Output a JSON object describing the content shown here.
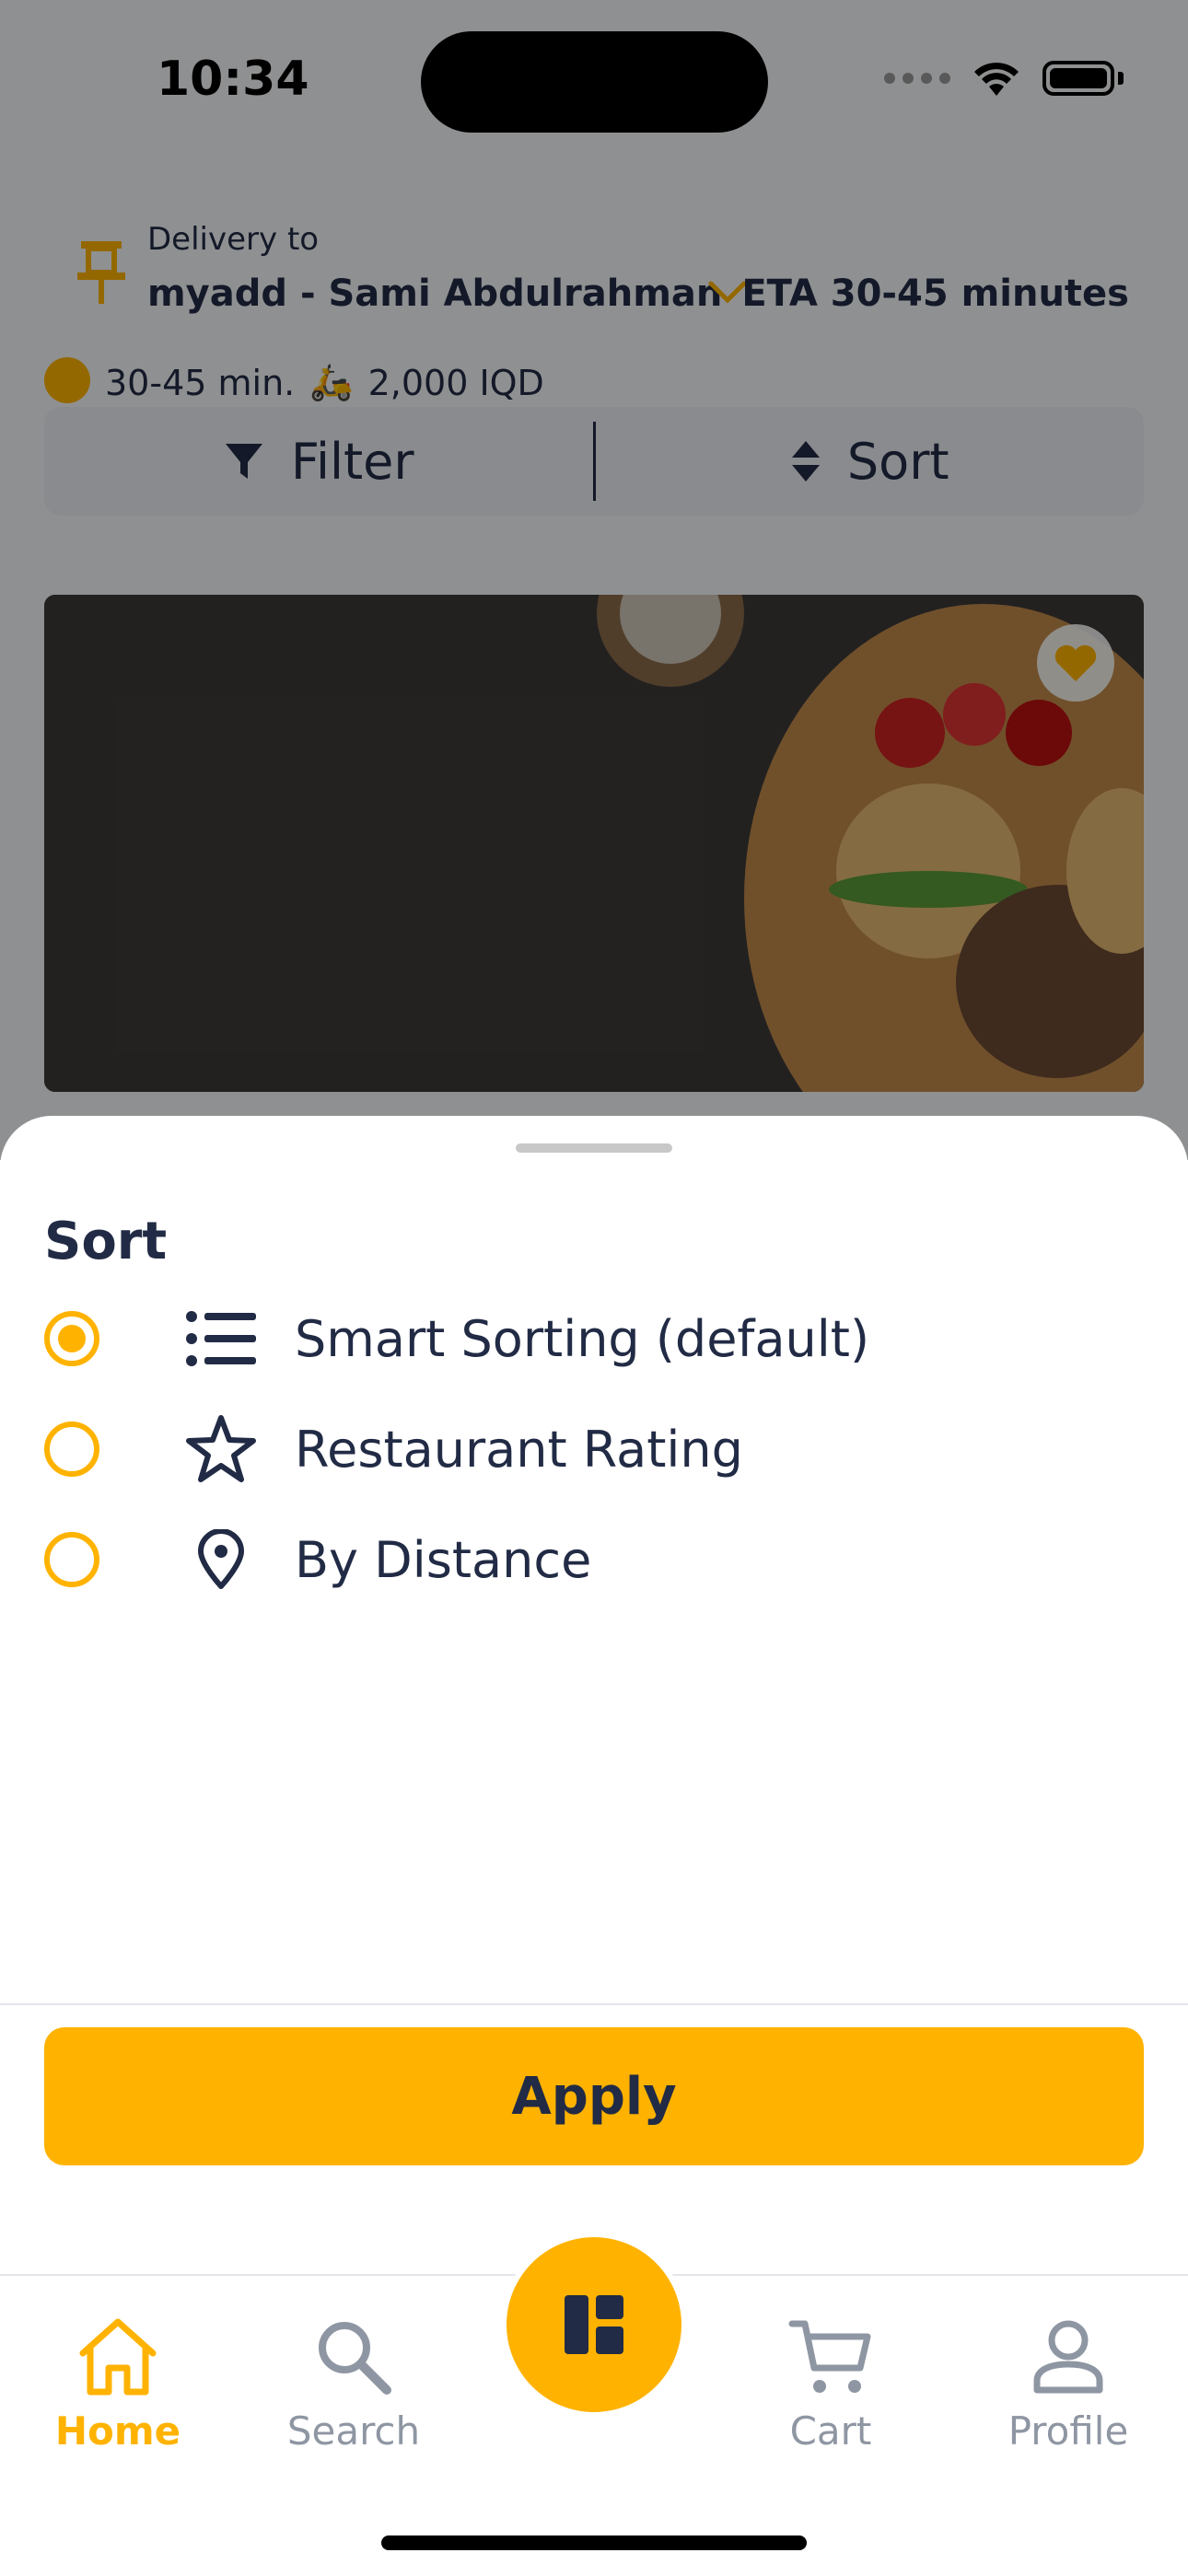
{
  "status_bar": {
    "time": "10:34"
  },
  "header": {
    "delivery_label": "Delivery to",
    "address": "myadd - Sami Abdulrahman",
    "eta": "ETA 30-45 minutes"
  },
  "restaurant_meta": {
    "time": "30-45 min.",
    "fee": "2,000 IQD"
  },
  "toolbar": {
    "filter_label": "Filter",
    "sort_label": "Sort"
  },
  "sort_sheet": {
    "title": "Sort",
    "options": [
      {
        "label": "Smart Sorting (default)",
        "icon": "list-icon",
        "selected": true
      },
      {
        "label": "Restaurant Rating",
        "icon": "star-icon",
        "selected": false
      },
      {
        "label": "By Distance",
        "icon": "location-pin-icon",
        "selected": false
      }
    ],
    "apply_label": "Apply"
  },
  "bottom_nav": {
    "items": [
      {
        "label": "Home",
        "icon": "home-icon",
        "active": true
      },
      {
        "label": "Search",
        "icon": "search-icon",
        "active": false
      },
      {
        "label": "Cart",
        "icon": "cart-icon",
        "active": false
      },
      {
        "label": "Profile",
        "icon": "profile-icon",
        "active": false
      }
    ],
    "center_icon": "dashboard-icon"
  },
  "colors": {
    "accent": "#ffb300",
    "text": "#222b45",
    "muted": "#8f96a3"
  }
}
